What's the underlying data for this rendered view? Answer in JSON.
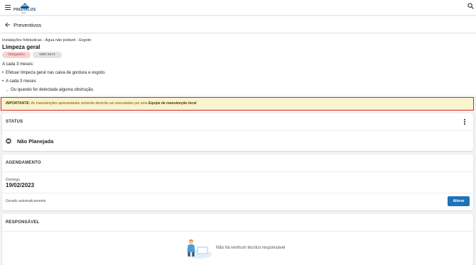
{
  "app": {
    "logo_text": "PREDIALIZE",
    "logo_subtext": "brasil"
  },
  "header": {
    "title": "Preventivos"
  },
  "info": {
    "breadcrumb": "Instalações hidráulicas - Água não potável - Esgoto",
    "title": "Limpeza geral",
    "tags": [
      "Obrigatório",
      "NBR 5674"
    ],
    "frequency": "A cada 3 meses:",
    "items": [
      "Efetuar limpeza geral nas caixa de gordura e esgoto.",
      "A cada 3 meses",
      "Ou quando for detectada alguma obstrução."
    ]
  },
  "important": {
    "label": "IMPORTANTE:",
    "text": " As manutenções apresentadas somente deverão ser executadas por uma ",
    "emphasis": "Equipe de manutenção local"
  },
  "status": {
    "title": "STATUS",
    "value": "Não Planejada"
  },
  "schedule": {
    "title": "AGENDAMENTO",
    "day": "Domingo",
    "date": "19/02/2023",
    "note": "Gerado automaticamente",
    "button_label": "Alterar"
  },
  "responsible": {
    "title": "RESPONSÁVEL",
    "empty_text": "Não há nenhum técnico responsável"
  },
  "colors": {
    "brand": "#1d4f7c",
    "primary_button": "#1f73b7",
    "warning_bg": "#fbf3cd",
    "highlight_border": "#d6282b",
    "required_tag_bg": "#f6d3d2"
  },
  "icons": [
    "menu-icon",
    "logo-icon",
    "search-icon",
    "back-arrow-icon",
    "more-vertical-icon",
    "status-minus-icon",
    "technician-illustration"
  ]
}
